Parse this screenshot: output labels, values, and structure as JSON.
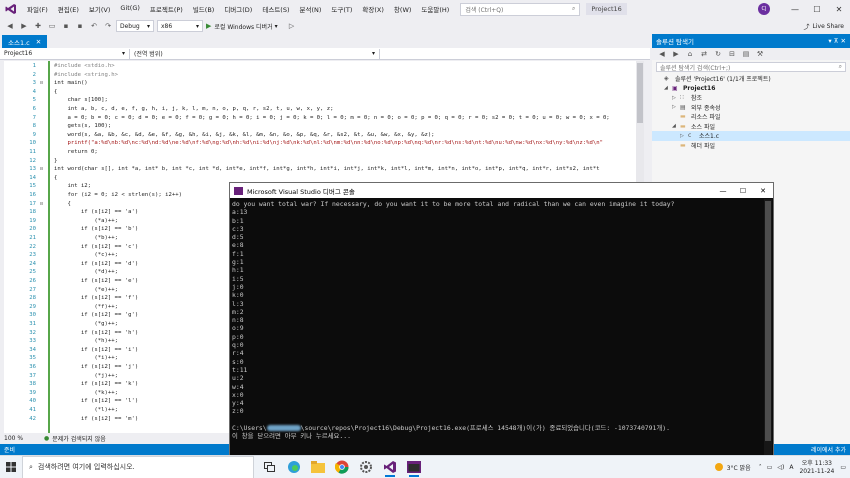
{
  "menubar": {
    "items": [
      "파일(F)",
      "편집(E)",
      "보기(V)",
      "Git(G)",
      "프로젝트(P)",
      "빌드(B)",
      "디버그(D)",
      "테스트(S)",
      "분석(N)",
      "도구(T)",
      "확장(X)",
      "창(W)",
      "도움말(H)"
    ],
    "search_placeholder": "검색 (Ctrl+Q)",
    "project_badge": "Project16",
    "avatar_initials": "CJ"
  },
  "toolbar": {
    "config": "Debug",
    "platform": "x86",
    "run_label": "로컬 Windows 디버거",
    "live_share": "Live Share"
  },
  "editor": {
    "tab_label": "소스1.c",
    "nav_project": "Project16",
    "nav_scope": "(전역 범위)",
    "zoom": "100 %",
    "issues": "문제가 검색되지 않음",
    "lines": [
      {
        "n": "1",
        "t": "#include <stdio.h>",
        "c": "pp"
      },
      {
        "n": "2",
        "t": "#include <string.h>",
        "c": "pp"
      },
      {
        "n": "3",
        "t": "int main()",
        "c": ""
      },
      {
        "n": "4",
        "t": "{",
        "c": ""
      },
      {
        "n": "5",
        "t": "    char s[100];",
        "c": ""
      },
      {
        "n": "6",
        "t": "    int a, b, c, d, e, f, g, h, i, j, k, l, m, n, o, p, q, r, s2, t, u, w, x, y, z;",
        "c": ""
      },
      {
        "n": "7",
        "t": "    a = 0; b = 0; c = 0; d = 0; e = 0; f = 0; g = 0; h = 0; i = 0; j = 0; k = 0; l = 0; m = 0; n = 0; o = 0; p = 0; q = 0; r = 0; s2 = 0; t = 0; u = 0; w = 0; x = 0;",
        "c": ""
      },
      {
        "n": "8",
        "t": "    gets(s, 100);",
        "c": ""
      },
      {
        "n": "9",
        "t": "    word(s, &a, &b, &c, &d, &e, &f, &g, &h, &i, &j, &k, &l, &m, &n, &o, &p, &q, &r, &s2, &t, &u, &w, &x, &y, &z);",
        "c": ""
      },
      {
        "n": "10",
        "t": "    printf(\"a:%d\\nb:%d\\nc:%d\\nd:%d\\ne:%d\\nf:%d\\ng:%d\\nh:%d\\ni:%d\\nj:%d\\nk:%d\\nl:%d\\nm:%d\\nn:%d\\no:%d\\np:%d\\nq:%d\\nr:%d\\ns:%d\\nt:%d\\nu:%d\\nw:%d\\nx:%d\\ny:%d\\nz:%d\\n\"",
        "c": "str"
      },
      {
        "n": "11",
        "t": "    return 0;",
        "c": ""
      },
      {
        "n": "12",
        "t": "}",
        "c": ""
      },
      {
        "n": "13",
        "t": "int word(char s[], int *a, int* b, int *c, int *d, int*e, int*f, int*g, int*h, int*i, int*j, int*k, int*l, int*m, int*n, int*o, int*p, int*q, int*r, int*s2, int*t",
        "c": ""
      },
      {
        "n": "14",
        "t": "{",
        "c": ""
      },
      {
        "n": "15",
        "t": "    int i2;",
        "c": ""
      },
      {
        "n": "16",
        "t": "    for (i2 = 0; i2 < strlen(s); i2++)",
        "c": ""
      },
      {
        "n": "17",
        "t": "    {",
        "c": ""
      },
      {
        "n": "18",
        "t": "        if (s[i2] == 'a')",
        "c": ""
      },
      {
        "n": "19",
        "t": "            (*a)++;",
        "c": ""
      },
      {
        "n": "20",
        "t": "        if (s[i2] == 'b')",
        "c": ""
      },
      {
        "n": "21",
        "t": "            (*b)++;",
        "c": ""
      },
      {
        "n": "22",
        "t": "        if (s[i2] == 'c')",
        "c": ""
      },
      {
        "n": "23",
        "t": "            (*c)++;",
        "c": ""
      },
      {
        "n": "24",
        "t": "        if (s[i2] == 'd')",
        "c": ""
      },
      {
        "n": "25",
        "t": "            (*d)++;",
        "c": ""
      },
      {
        "n": "26",
        "t": "        if (s[i2] == 'e')",
        "c": ""
      },
      {
        "n": "27",
        "t": "            (*e)++;",
        "c": ""
      },
      {
        "n": "28",
        "t": "        if (s[i2] == 'f')",
        "c": ""
      },
      {
        "n": "29",
        "t": "            (*f)++;",
        "c": ""
      },
      {
        "n": "30",
        "t": "        if (s[i2] == 'g')",
        "c": ""
      },
      {
        "n": "31",
        "t": "            (*g)++;",
        "c": ""
      },
      {
        "n": "32",
        "t": "        if (s[i2] == 'h')",
        "c": ""
      },
      {
        "n": "33",
        "t": "            (*h)++;",
        "c": ""
      },
      {
        "n": "34",
        "t": "        if (s[i2] == 'i')",
        "c": ""
      },
      {
        "n": "35",
        "t": "            (*i)++;",
        "c": ""
      },
      {
        "n": "36",
        "t": "        if (s[i2] == 'j')",
        "c": ""
      },
      {
        "n": "37",
        "t": "            (*j)++;",
        "c": ""
      },
      {
        "n": "38",
        "t": "        if (s[i2] == 'k')",
        "c": ""
      },
      {
        "n": "39",
        "t": "            (*k)++;",
        "c": ""
      },
      {
        "n": "40",
        "t": "        if (s[i2] == 'l')",
        "c": ""
      },
      {
        "n": "41",
        "t": "            (*l)++;",
        "c": ""
      },
      {
        "n": "42",
        "t": "        if (s[i2] == 'm')",
        "c": ""
      }
    ]
  },
  "solution_explorer": {
    "title": "솔루션 탐색기",
    "search_placeholder": "솔루션 탐색기 검색(Ctrl+;)",
    "items": [
      {
        "label": "솔루션 'Project16' (1/1개 프로젝트)",
        "depth": 0,
        "arrow": "",
        "icon": "solution-icon"
      },
      {
        "label": "Project16",
        "depth": 1,
        "arrow": "◢",
        "icon": "project-icon"
      },
      {
        "label": "참조",
        "depth": 2,
        "arrow": "▷",
        "icon": "references-icon"
      },
      {
        "label": "외부 종속성",
        "depth": 2,
        "arrow": "▷",
        "icon": "external-deps-icon"
      },
      {
        "label": "리소스 파일",
        "depth": 2,
        "arrow": "",
        "icon": "folder-icon"
      },
      {
        "label": "소스 파일",
        "depth": 2,
        "arrow": "◢",
        "icon": "folder-icon"
      },
      {
        "label": "소스1.c",
        "depth": 3,
        "arrow": "▷",
        "icon": "c-file-icon"
      },
      {
        "label": "헤더 파일",
        "depth": 2,
        "arrow": "",
        "icon": "folder-icon"
      }
    ],
    "bottom_tab": "레이에서 추가"
  },
  "statusbar": {
    "left": "준비"
  },
  "console": {
    "title": "Microsoft Visual Studio 디버그 콘솔",
    "input_line": "do you want total war? If necessary, do you want it to be more total and radical than we can even imagine it today?",
    "results": [
      "a:13",
      "b:1",
      "c:3",
      "d:5",
      "e:8",
      "f:1",
      "g:1",
      "h:1",
      "i:5",
      "j:0",
      "k:0",
      "l:3",
      "m:2",
      "n:8",
      "o:9",
      "p:0",
      "q:0",
      "r:4",
      "s:0",
      "t:11",
      "u:2",
      "w:4",
      "x:0",
      "y:4",
      "z:0"
    ],
    "exit_prefix": "C:\\Users\\",
    "exit_suffix": "\\source\\repos\\Project16\\Debug\\Project16.exe(프로세스 14548개)이(가) 종료되었습니다(코드: -1073740791개).",
    "close_hint": "이 창을 닫으려면 아무 키나 누르세요..."
  },
  "taskbar": {
    "search_placeholder": "검색하려면 여기에 입력하십시오.",
    "weather": "3°C 맑음",
    "time": "오후 11:33",
    "date": "2021-11-24"
  },
  "colors": {
    "accent": "#007acc",
    "vs_purple": "#68217a"
  }
}
